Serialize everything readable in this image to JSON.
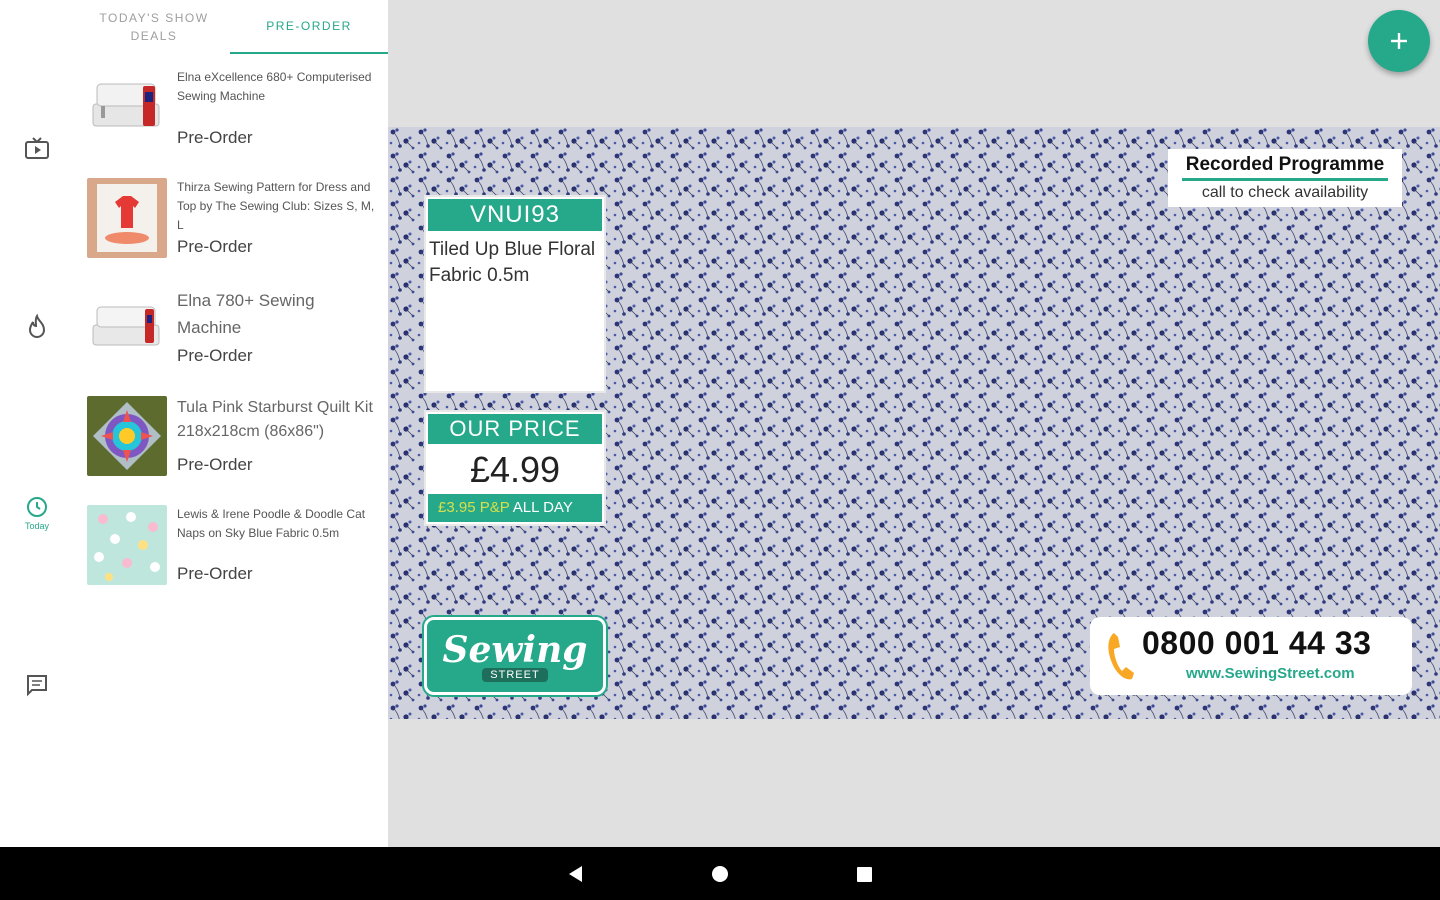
{
  "colors": {
    "accent": "#26a88a",
    "background": "#e0e0e0",
    "price_highlight": "#d6e04a"
  },
  "rail": {
    "items": [
      {
        "icon": "tv-icon",
        "label": ""
      },
      {
        "icon": "flame-icon",
        "label": ""
      },
      {
        "icon": "clock-icon",
        "label": "Today"
      },
      {
        "icon": "chat-icon",
        "label": ""
      }
    ]
  },
  "tabs": [
    {
      "label_line1": "TODAY'S SHOW",
      "label_line2": "DEALS"
    },
    {
      "label": "PRE-ORDER"
    }
  ],
  "items": [
    {
      "title": "Elna eXcellence 680+ Computerised Sewing Machine",
      "status": "Pre-Order"
    },
    {
      "title": "Thirza Sewing Pattern for Dress and Top by The Sewing Club: Sizes S, M, L",
      "status": "Pre-Order"
    },
    {
      "title": "Elna 780+ Sewing Machine",
      "status": "Pre-Order"
    },
    {
      "title": "Tula Pink Starburst Quilt Kit 218x218cm (86x86\")",
      "status": "Pre-Order"
    },
    {
      "title": "Lewis & Irene Poodle & Doodle Cat Naps on Sky Blue Fabric 0.5m",
      "status": "Pre-Order"
    }
  ],
  "video": {
    "product_code": "VNUI93",
    "product_desc": "Tiled Up Blue Floral Fabric 0.5m",
    "price_header": "OUR PRICE",
    "price": "£4.99",
    "pp_value": "£3.95 P&P",
    "pp_suffix": "ALL DAY",
    "logo_main": "Sewing",
    "logo_sub": "STREET",
    "recorded_title": "Recorded Programme",
    "recorded_sub": "call to check availability",
    "phone_number": "0800 001 44 33",
    "phone_url": "www.SewingStreet.com"
  },
  "fab": {
    "icon": "plus-icon"
  },
  "navbar": {
    "back": "back-icon",
    "home": "home-icon",
    "recents": "recents-icon"
  }
}
